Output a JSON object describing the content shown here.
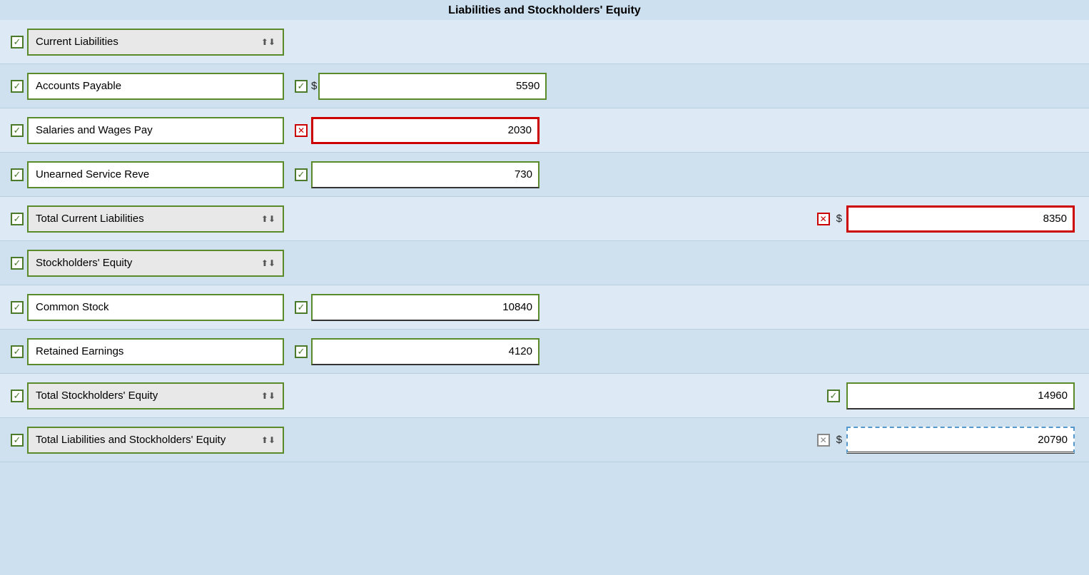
{
  "header": {
    "title": "Liabilities and Stockholders' Equity"
  },
  "rows": [
    {
      "id": "current-liabilities-header",
      "type": "header-dropdown",
      "check": "green",
      "label": "Current Liabilities",
      "midValue": null,
      "rightValue": null,
      "alt": false
    },
    {
      "id": "accounts-payable",
      "type": "data",
      "check": "green",
      "label": "Accounts Payable",
      "midCheck": "green",
      "midDollar": "$",
      "midValue": "5590",
      "midBorder": "normal",
      "rightValue": null,
      "alt": true
    },
    {
      "id": "salaries-wages",
      "type": "data",
      "check": "green",
      "label": "Salaries and Wages Pay",
      "midCheck": "red",
      "midDollar": null,
      "midValue": "2030",
      "midBorder": "red",
      "rightValue": null,
      "alt": false
    },
    {
      "id": "unearned-service",
      "type": "data",
      "check": "green",
      "label": "Unearned Service Reve",
      "midCheck": "green",
      "midDollar": null,
      "midValue": "730",
      "midBorder": "normal",
      "rightValue": null,
      "alt": true
    },
    {
      "id": "total-current-liabilities",
      "type": "total-dropdown",
      "check": "green",
      "label": "Total Current Liabilities",
      "midValue": null,
      "rightCheck": "red",
      "rightDollar": "$",
      "rightValue": "8350",
      "rightBorder": "red",
      "alt": false
    },
    {
      "id": "stockholders-equity-header",
      "type": "header-dropdown",
      "check": "green",
      "label": "Stockholders' Equity",
      "midValue": null,
      "rightValue": null,
      "alt": true
    },
    {
      "id": "common-stock",
      "type": "data",
      "check": "green",
      "label": "Common Stock",
      "midCheck": "green",
      "midDollar": null,
      "midValue": "10840",
      "midBorder": "normal",
      "rightValue": null,
      "alt": false
    },
    {
      "id": "retained-earnings",
      "type": "data",
      "check": "green",
      "label": "Retained Earnings",
      "midCheck": "green",
      "midDollar": null,
      "midValue": "4120",
      "midBorder": "normal",
      "rightValue": null,
      "alt": true
    },
    {
      "id": "total-stockholders-equity",
      "type": "total-dropdown",
      "check": "green",
      "label": "Total Stockholders' Equity",
      "midValue": null,
      "rightCheck": "green",
      "rightDollar": null,
      "rightValue": "14960",
      "rightBorder": "normal",
      "alt": false
    },
    {
      "id": "total-liabilities-equity",
      "type": "total-dropdown",
      "check": "green",
      "label": "Total Liabilities and Stockholders' Equity",
      "midValue": null,
      "rightCheck": "gray-x",
      "rightDollar": "$",
      "rightValue": "20790",
      "rightBorder": "blue-dashed",
      "alt": true
    }
  ]
}
